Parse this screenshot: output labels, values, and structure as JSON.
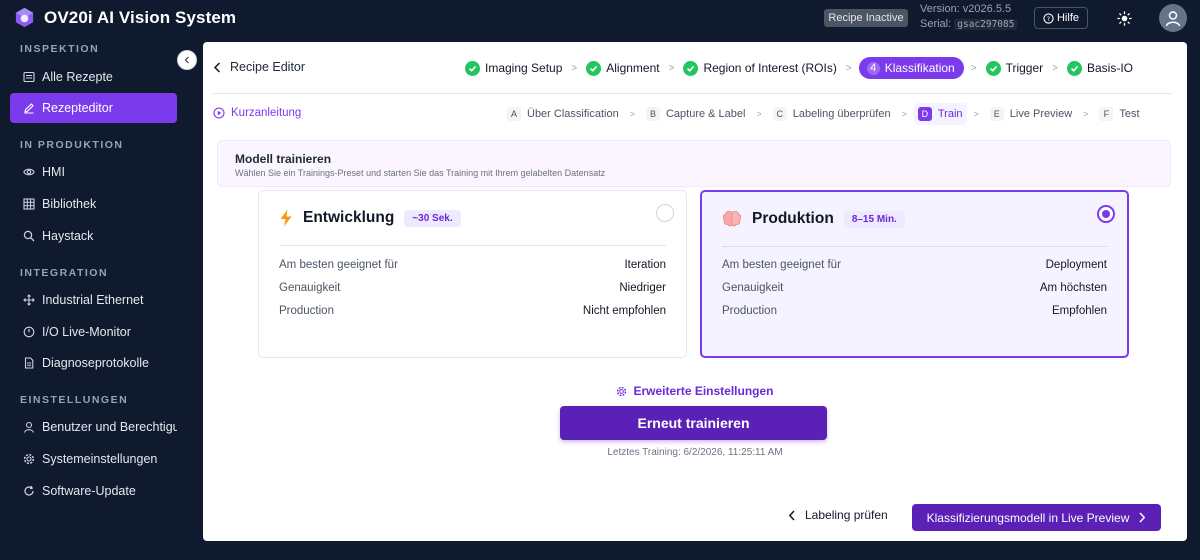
{
  "app": {
    "title": "OV20i AI Vision System",
    "recipe_status": "Recipe Inactive",
    "version": "Version: v2026.5.5",
    "serial_label": "Serial:",
    "serial_value": "gsac297085",
    "help_label": "Hilfe"
  },
  "sidebar": {
    "sections": [
      {
        "label": "INSPEKTION",
        "items": [
          {
            "label": "Alle Rezepte",
            "icon": "list-icon"
          },
          {
            "label": "Rezepteditor",
            "icon": "pencil-icon",
            "active": true
          }
        ]
      },
      {
        "label": "IN PRODUKTION",
        "items": [
          {
            "label": "HMI",
            "icon": "eye-icon"
          },
          {
            "label": "Bibliothek",
            "icon": "grid-icon"
          },
          {
            "label": "Haystack",
            "icon": "search-icon"
          }
        ]
      },
      {
        "label": "INTEGRATION",
        "items": [
          {
            "label": "Industrial Ethernet",
            "icon": "network-icon"
          },
          {
            "label": "I/O Live-Monitor",
            "icon": "io-icon"
          },
          {
            "label": "Diagnoseprotokolle",
            "icon": "document-icon"
          }
        ]
      },
      {
        "label": "EINSTELLUNGEN",
        "items": [
          {
            "label": "Benutzer und Berechtigungen",
            "icon": "user-icon"
          },
          {
            "label": "Systemeinstellungen",
            "icon": "gear-icon"
          },
          {
            "label": "Software-Update",
            "icon": "refresh-icon"
          }
        ]
      }
    ]
  },
  "editor": {
    "back_label": "Recipe Editor",
    "steps": [
      {
        "label": "Imaging Setup",
        "state": "done"
      },
      {
        "label": "Alignment",
        "state": "done"
      },
      {
        "label": "Region of Interest (ROIs)",
        "state": "done"
      },
      {
        "label": "Klassifikation",
        "state": "active",
        "number": "4"
      },
      {
        "label": "Trigger",
        "state": "done"
      },
      {
        "label": "Basis-IO",
        "state": "done"
      }
    ],
    "quick_guide": "Kurzanleitung",
    "substeps": [
      {
        "letter": "A",
        "label": "Über Classification"
      },
      {
        "letter": "B",
        "label": "Capture & Label"
      },
      {
        "letter": "C",
        "label": "Labeling überprüfen"
      },
      {
        "letter": "D",
        "label": "Train",
        "active": true
      },
      {
        "letter": "E",
        "label": "Live Preview"
      },
      {
        "letter": "F",
        "label": "Test"
      }
    ]
  },
  "train": {
    "title": "Modell trainieren",
    "subtitle": "Wählen Sie ein Trainings-Preset und starten Sie das Training mit Ihrem gelabelten Datensatz",
    "presets": [
      {
        "name": "Entwicklung",
        "badge": "~30 Sek.",
        "icon": "lightning-icon",
        "selected": false,
        "rows": [
          {
            "k": "Am besten geeignet für",
            "v": "Iteration"
          },
          {
            "k": "Genauigkeit",
            "v": "Niedriger"
          },
          {
            "k": "Production",
            "v": "Nicht empfohlen"
          }
        ]
      },
      {
        "name": "Produktion",
        "badge": "8–15 Min.",
        "icon": "brain-icon",
        "selected": true,
        "rows": [
          {
            "k": "Am besten geeignet für",
            "v": "Deployment"
          },
          {
            "k": "Genauigkeit",
            "v": "Am höchsten"
          },
          {
            "k": "Production",
            "v": "Empfohlen"
          }
        ]
      }
    ],
    "advanced_label": "Erweiterte Einstellungen",
    "retrain_label": "Erneut trainieren",
    "last_training": "Letztes Training: 6/2/2026, 11:25:11 AM"
  },
  "footer": {
    "prev_label": "Labeling prüfen",
    "next_label": "Klassifizierungsmodell in Live Preview"
  },
  "colors": {
    "accent": "#7c3aed",
    "accent_dark": "#5b21b6",
    "success": "#22c55e",
    "sidebar_bg": "#0f1a2e"
  }
}
